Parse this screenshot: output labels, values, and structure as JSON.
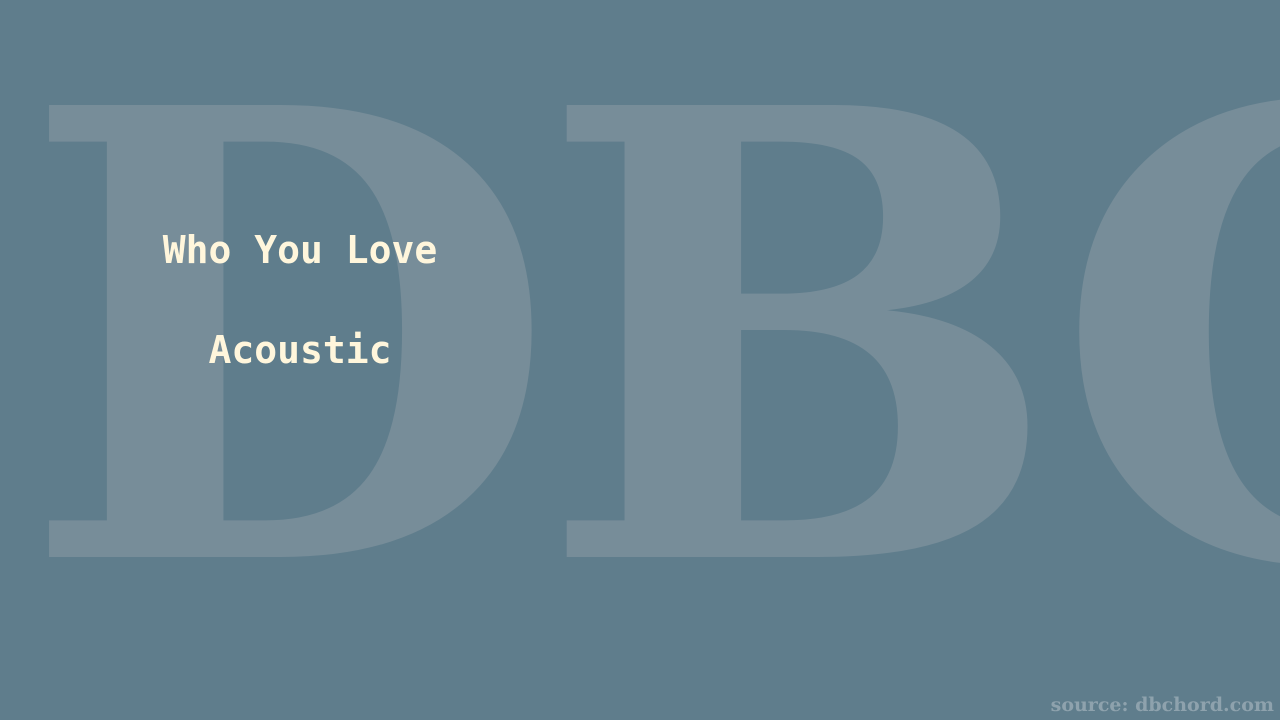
{
  "background_color": "#5f7d8c",
  "watermark": {
    "text": "DBC",
    "color": "#778d99"
  },
  "song": {
    "title": "Who You Love",
    "version": "Acoustic",
    "text_color": "#fff6dc"
  },
  "footer": {
    "source": "source: dbchord.com"
  }
}
